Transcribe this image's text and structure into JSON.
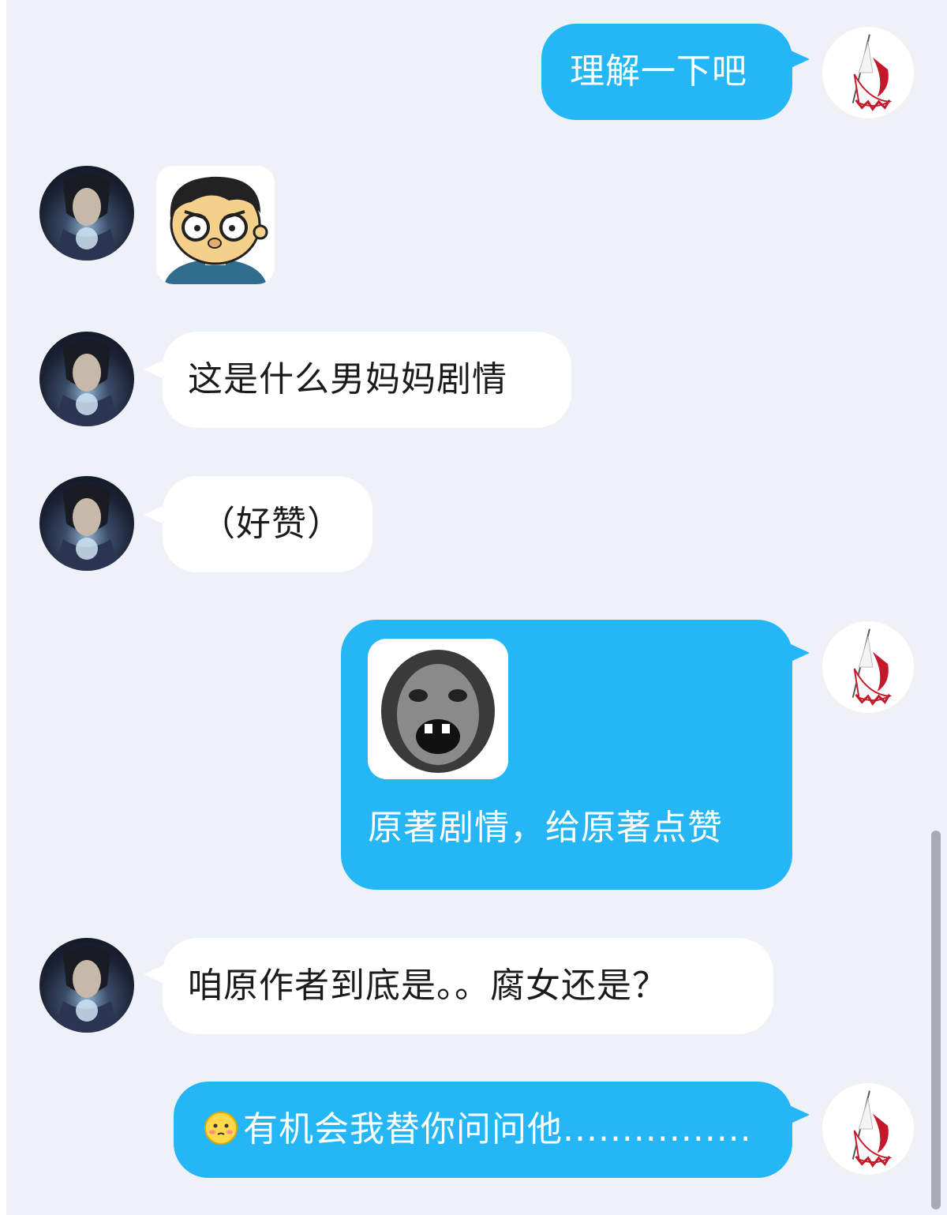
{
  "messages": [
    {
      "side": "out",
      "text": "理解一下吧"
    },
    {
      "side": "in",
      "sticker": "cartoon-boy-sticker"
    },
    {
      "side": "in",
      "text": "这是什么男妈妈剧情"
    },
    {
      "side": "in",
      "text": "（好赞）"
    },
    {
      "side": "out",
      "sticker": "meme-face-sticker",
      "text": "原著剧情，给原著点赞"
    },
    {
      "side": "in",
      "text": "咱原作者到底是。。腐女还是？"
    },
    {
      "side": "out",
      "emoji": "blush-emoji",
      "text": "有机会我替你问问他................"
    }
  ],
  "colors": {
    "out_bubble": "#25b6f5",
    "in_bubble": "#ffffff",
    "background": "#eef1f7"
  }
}
